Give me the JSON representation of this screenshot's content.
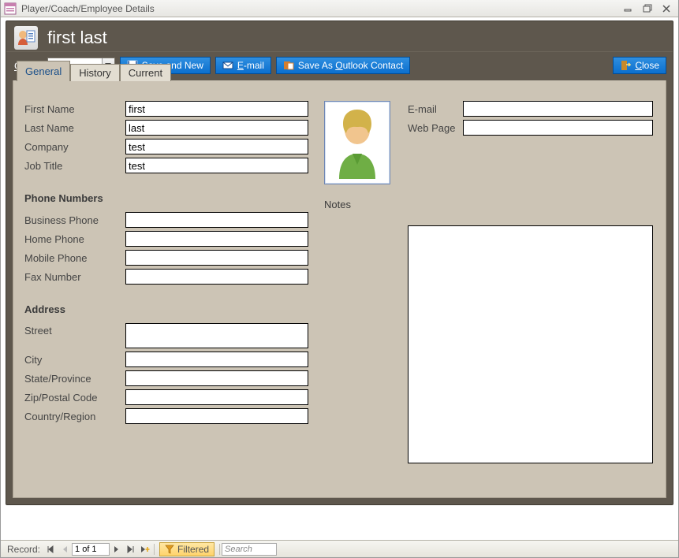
{
  "window": {
    "title": "Player/Coach/Employee Details"
  },
  "header": {
    "page_title": "first last",
    "goto_label": "Go to",
    "buttons": {
      "save_new_pre": "S",
      "save_new_post": "ave and New",
      "email_pre": "E",
      "email_post": "-mail",
      "outlook_pre": "Save As ",
      "outlook_u": "O",
      "outlook_post": "utlook Contact",
      "close_pre": "C",
      "close_post": "lose"
    }
  },
  "tabs": {
    "general": "General",
    "history": "History",
    "current": "Current"
  },
  "labels": {
    "first_name": "First Name",
    "last_name": "Last Name",
    "company": "Company",
    "job_title": "Job Title",
    "phone_section": "Phone Numbers",
    "business_phone": "Business Phone",
    "home_phone": "Home Phone",
    "mobile_phone": "Mobile Phone",
    "fax_number": "Fax Number",
    "address_section": "Address",
    "street": "Street",
    "city": "City",
    "state": "State/Province",
    "zip": "Zip/Postal Code",
    "country": "Country/Region",
    "email": "E-mail",
    "webpage": "Web Page",
    "notes": "Notes"
  },
  "values": {
    "first_name": "first",
    "last_name": "last",
    "company": "test",
    "job_title": "test",
    "business_phone": "",
    "home_phone": "",
    "mobile_phone": "",
    "fax_number": "",
    "street": "",
    "city": "",
    "state": "",
    "zip": "",
    "country": "",
    "email": "",
    "webpage": "",
    "notes": ""
  },
  "recordbar": {
    "label": "Record:",
    "position": "1 of 1",
    "filtered": "Filtered",
    "search_placeholder": "Search"
  }
}
